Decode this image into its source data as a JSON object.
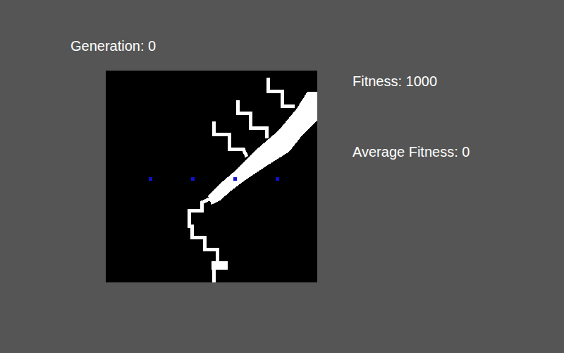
{
  "header": {
    "generation": "Generation: 0"
  },
  "stats": {
    "fitness": "Fitness: 1000",
    "average_fitness": "Average Fitness: 0"
  }
}
